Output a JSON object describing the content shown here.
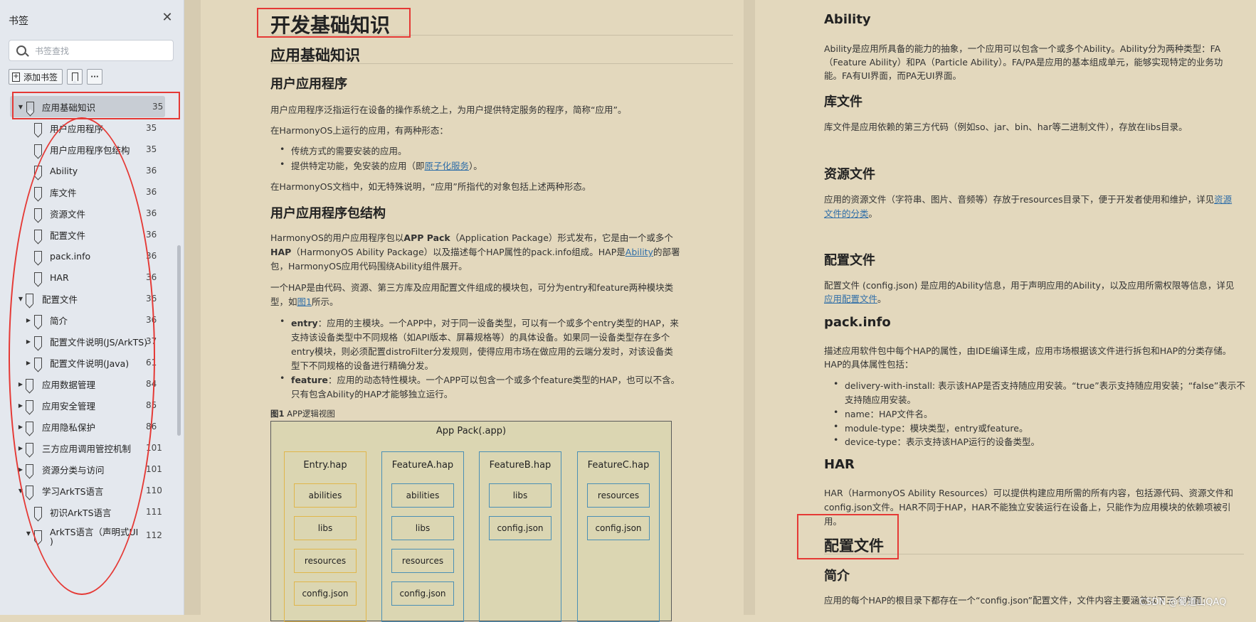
{
  "sidebar": {
    "title": "书签",
    "search_placeholder": "书签查找",
    "add_bookmark": "添加书签",
    "more": "···",
    "items": [
      {
        "label": "应用基础知识",
        "page": "35"
      },
      {
        "label": "用户应用程序",
        "page": "35"
      },
      {
        "label": "用户应用程序包结构",
        "page": "35"
      },
      {
        "label": "Ability",
        "page": "36"
      },
      {
        "label": "库文件",
        "page": "36"
      },
      {
        "label": "资源文件",
        "page": "36"
      },
      {
        "label": "配置文件",
        "page": "36"
      },
      {
        "label": "pack.info",
        "page": "36"
      },
      {
        "label": "HAR",
        "page": "36"
      },
      {
        "label": "配置文件",
        "page": "36"
      },
      {
        "label": "简介",
        "page": "36"
      },
      {
        "label": "配置文件说明(JS/ArkTS)",
        "page": "37"
      },
      {
        "label": "配置文件说明(Java)",
        "page": "61"
      },
      {
        "label": "应用数据管理",
        "page": "84"
      },
      {
        "label": "应用安全管理",
        "page": "85"
      },
      {
        "label": "应用隐私保护",
        "page": "86"
      },
      {
        "label": "三方应用调用管控机制",
        "page": "101"
      },
      {
        "label": "资源分类与访问",
        "page": "101"
      },
      {
        "label": "学习ArkTS语言",
        "page": "110"
      },
      {
        "label": "初识ArkTS语言",
        "page": "111"
      },
      {
        "label": "ArkTS语言（声明式UI",
        "label2": ")",
        "page": "112"
      }
    ]
  },
  "left_page": {
    "h0": "开发基础知识",
    "h1": "应用基础知识",
    "s1": "用户应用程序",
    "p1": "用户应用程序泛指运行在设备的操作系统之上，为用户提供特定服务的程序，简称“应用”。",
    "p2": "在HarmonyOS上运行的应用，有两种形态：",
    "b1": "传统方式的需要安装的应用。",
    "b2a": "提供特定功能，免安装的应用（即",
    "b2link": "原子化服务",
    "b2b": "）。",
    "p3": "在HarmonyOS文档中，如无特殊说明，“应用”所指代的对象包括上述两种形态。",
    "s2": "用户应用程序包结构",
    "p4a": "HarmonyOS的用户应用程序包以",
    "p4b": "APP Pack",
    "p4c": "（Application Package）形式发布，它是由一个或多个",
    "p4d": "HAP",
    "p4e": "（HarmonyOS Ability Package）以及描述每个HAP属性的pack.info组成。HAP是",
    "p4link": "Ability",
    "p4f": "的部署",
    "p4g": "包，HarmonyOS应用代码围绕Ability组件展开。",
    "p5a": "一个HAP是由代码、资源、第三方库及应用配置文件组成的模块包，可分为entry和feature两种模块类",
    "p5b": "型，如",
    "p5link": "图1",
    "p5c": "所示。",
    "e_head": "entry",
    "e1": "：应用的主模块。一个APP中，对于同一设备类型，可以有一个或多个entry类型的HAP，来",
    "e2": "支持该设备类型中不同规格（如API版本、屏幕规格等）的具体设备。如果同一设备类型存在多个",
    "e3": "entry模块，则必须配置distroFilter分发规则，使得应用市场在做应用的云端分发时，对该设备类",
    "e4": "型下不同规格的设备进行精确分发。",
    "f_head": "feature",
    "f1": "：应用的动态特性模块。一个APP可以包含一个或多个feature类型的HAP，也可以不含。",
    "f2": "只有包含Ability的HAP才能够独立运行。",
    "fig_no": "图1",
    "fig_cap": "APP逻辑视图",
    "diagram": {
      "title": "App Pack(.app)",
      "cols": [
        {
          "name": "Entry.hap",
          "cells": [
            "abilities",
            "libs",
            "resources",
            "config.json"
          ],
          "color": "#e0b64a"
        },
        {
          "name": "FeatureA.hap",
          "cells": [
            "abilities",
            "libs",
            "resources",
            "config.json"
          ],
          "color": "#4a8fb5"
        },
        {
          "name": "FeatureB.hap",
          "cells": [
            "libs",
            "config.json"
          ],
          "color": "#4a8fb5"
        },
        {
          "name": "FeatureC.hap",
          "cells": [
            "resources",
            "config.json"
          ],
          "color": "#4a8fb5"
        }
      ]
    }
  },
  "right_page": {
    "ability_h": "Ability",
    "ability_p1": "Ability是应用所具备的能力的抽象，一个应用可以包含一个或多个Ability。Ability分为两种类型：FA",
    "ability_p2": "（Feature Ability）和PA（Particle Ability）。FA/PA是应用的基本组成单元，能够实现特定的业务功",
    "ability_p3": "能。FA有UI界面，而PA无UI界面。",
    "lib_h": "库文件",
    "lib_p": "库文件是应用依赖的第三方代码（例如so、jar、bin、har等二进制文件），存放在libs目录。",
    "res_h": "资源文件",
    "res_p1": "应用的资源文件（字符串、图片、音频等）存放于resources目录下，便于开发者使用和维护，详见",
    "res_link1": "资源",
    "res_link2": "文件的分类",
    "res_end": "。",
    "cfg_h": "配置文件",
    "cfg_p1": "配置文件 (config.json) 是应用的Ability信息，用于声明应用的Ability，以及应用所需权限等信息，详见",
    "cfg_link": "应用配置文件",
    "cfg_end": "。",
    "pack_h": "pack.info",
    "pack_p1": "描述应用软件包中每个HAP的属性，由IDE编译生成，应用市场根据该文件进行拆包和HAP的分类存储。",
    "pack_p2": "HAP的具体属性包括：",
    "pb1a": "delivery-with-install: 表示该HAP是否支持随应用安装。“true”表示支持随应用安装；“false”表示不",
    "pb1b": "支持随应用安装。",
    "pb2": "name：HAP文件名。",
    "pb3": "module-type：模块类型，entry或feature。",
    "pb4": "device-type：表示支持该HAP运行的设备类型。",
    "har_h": "HAR",
    "har_p1": "HAR（HarmonyOS Ability Resources）可以提供构建应用所需的所有内容，包括源代码、资源文件和",
    "har_p2": "config.json文件。HAR不同于HAP，HAR不能独立安装运行在设备上，只能作为应用模块的依赖项被引",
    "har_p3": "用。",
    "cfg2_h": "配置文件",
    "intro_h": "简介",
    "intro_p": "应用的每个HAP的根目录下都存在一个“config.json”配置文件，文件内容主要涵盖以下三个方面：",
    "watermark": "CSDN @蜀道山QAQ"
  }
}
